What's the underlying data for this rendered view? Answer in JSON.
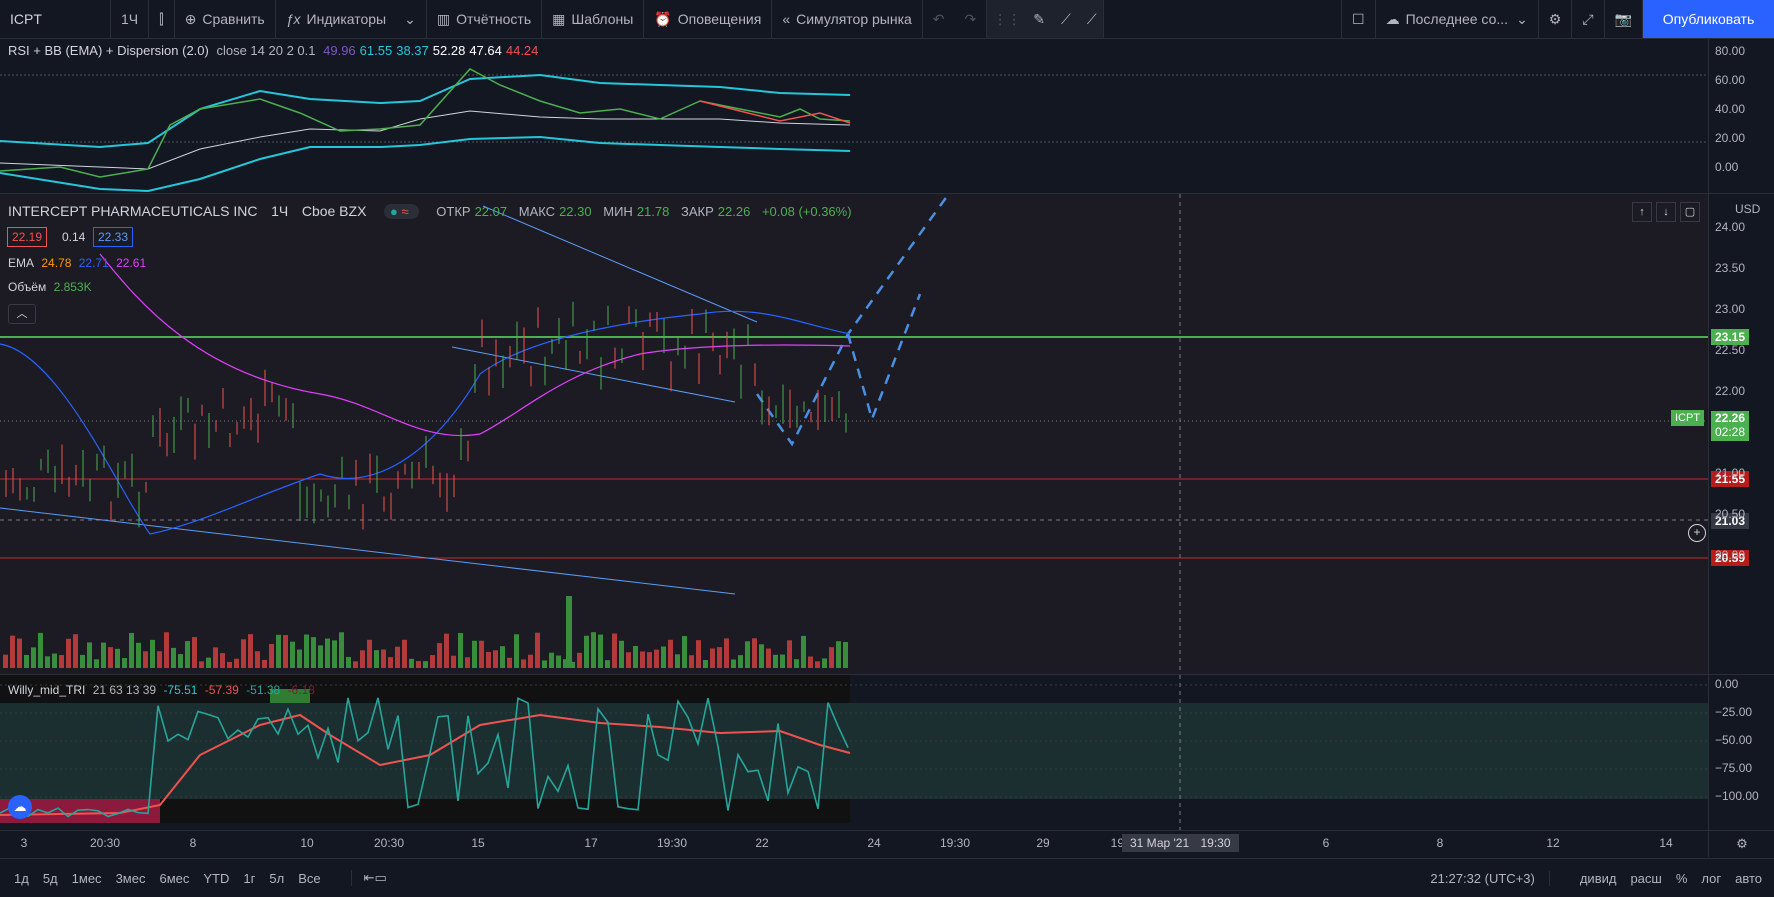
{
  "toolbar": {
    "symbol": "ICPT",
    "interval": "1Ч",
    "compare": "Сравнить",
    "indicators": "Индикаторы",
    "reports": "Отчётность",
    "templates": "Шаблоны",
    "alerts": "Оповещения",
    "replay": "Симулятор рынка",
    "layout_name": "Последнее со...",
    "publish": "Опубликовать"
  },
  "rsi_pane": {
    "title": "RSI + BB (EMA) + Dispersion (2.0)",
    "params": "close 14 20 2 0.1",
    "values": [
      "49.96",
      "61.55",
      "38.37",
      "52.28",
      "47.64",
      "44.24"
    ],
    "value_colors": [
      "#7e57c2",
      "#26c6da",
      "#26c6da",
      "#ffffff",
      "#ffffff",
      "#ef5350"
    ],
    "axis": [
      "80.00",
      "60.00",
      "40.00",
      "20.00",
      "0.00"
    ]
  },
  "main_pane": {
    "title": "INTERCEPT PHARMACEUTICALS INC",
    "interval": "1Ч",
    "exchange": "Cboe BZX",
    "ohlc": {
      "open_label": "ОТКР",
      "open": "22.07",
      "high_label": "МАКС",
      "high": "22.30",
      "low_label": "МИН",
      "low": "21.78",
      "close_label": "ЗАКР",
      "close": "22.26",
      "change": "+0.08 (+0.36%)"
    },
    "bid": "22.19",
    "spread": "0.14",
    "ask": "22.33",
    "ema": {
      "label": "EMA",
      "v1": "24.78",
      "v2": "22.71",
      "v3": "22.61"
    },
    "volume": {
      "label": "Объём",
      "value": "2.853K"
    },
    "currency": "USD",
    "axis": [
      "24.00",
      "23.50",
      "23.00",
      "22.50",
      "22.00",
      "21.00",
      "20.50",
      "20.00"
    ],
    "levels": {
      "green": "23.15",
      "red1": "21.55",
      "crosshair": "21.03",
      "red2": "20.59"
    },
    "last": {
      "symbol": "ICPT",
      "price": "22.26",
      "countdown": "02:28"
    }
  },
  "willy_pane": {
    "title": "Willy_mid_TRI",
    "params": "21 63 13 39",
    "values": [
      "-75.51",
      "-57.39",
      "-51.38",
      "-6.18"
    ],
    "axis": [
      "0.00",
      "−25.00",
      "−50.00",
      "−75.00",
      "−100.00"
    ]
  },
  "time_axis": {
    "ticks": [
      "3",
      "20:30",
      "8",
      "10",
      "20:30",
      "15",
      "17",
      "19:30",
      "22",
      "24",
      "19:30",
      "29",
      "19:",
      "6",
      "8",
      "12",
      "14"
    ],
    "crosshair_date": "31 Мар '21",
    "crosshair_time": "19:30"
  },
  "bottom": {
    "ranges": [
      "1д",
      "5д",
      "1мес",
      "3мес",
      "6мес",
      "YTD",
      "1г",
      "5л",
      "Все"
    ],
    "clock": "21:27:32 (UTC+3)",
    "options": [
      "дивид",
      "расш",
      "%",
      "лог",
      "авто"
    ]
  },
  "colors": {
    "bg": "#131722",
    "up": "#4caf50",
    "down": "#ef5350",
    "accent": "#2962ff"
  }
}
